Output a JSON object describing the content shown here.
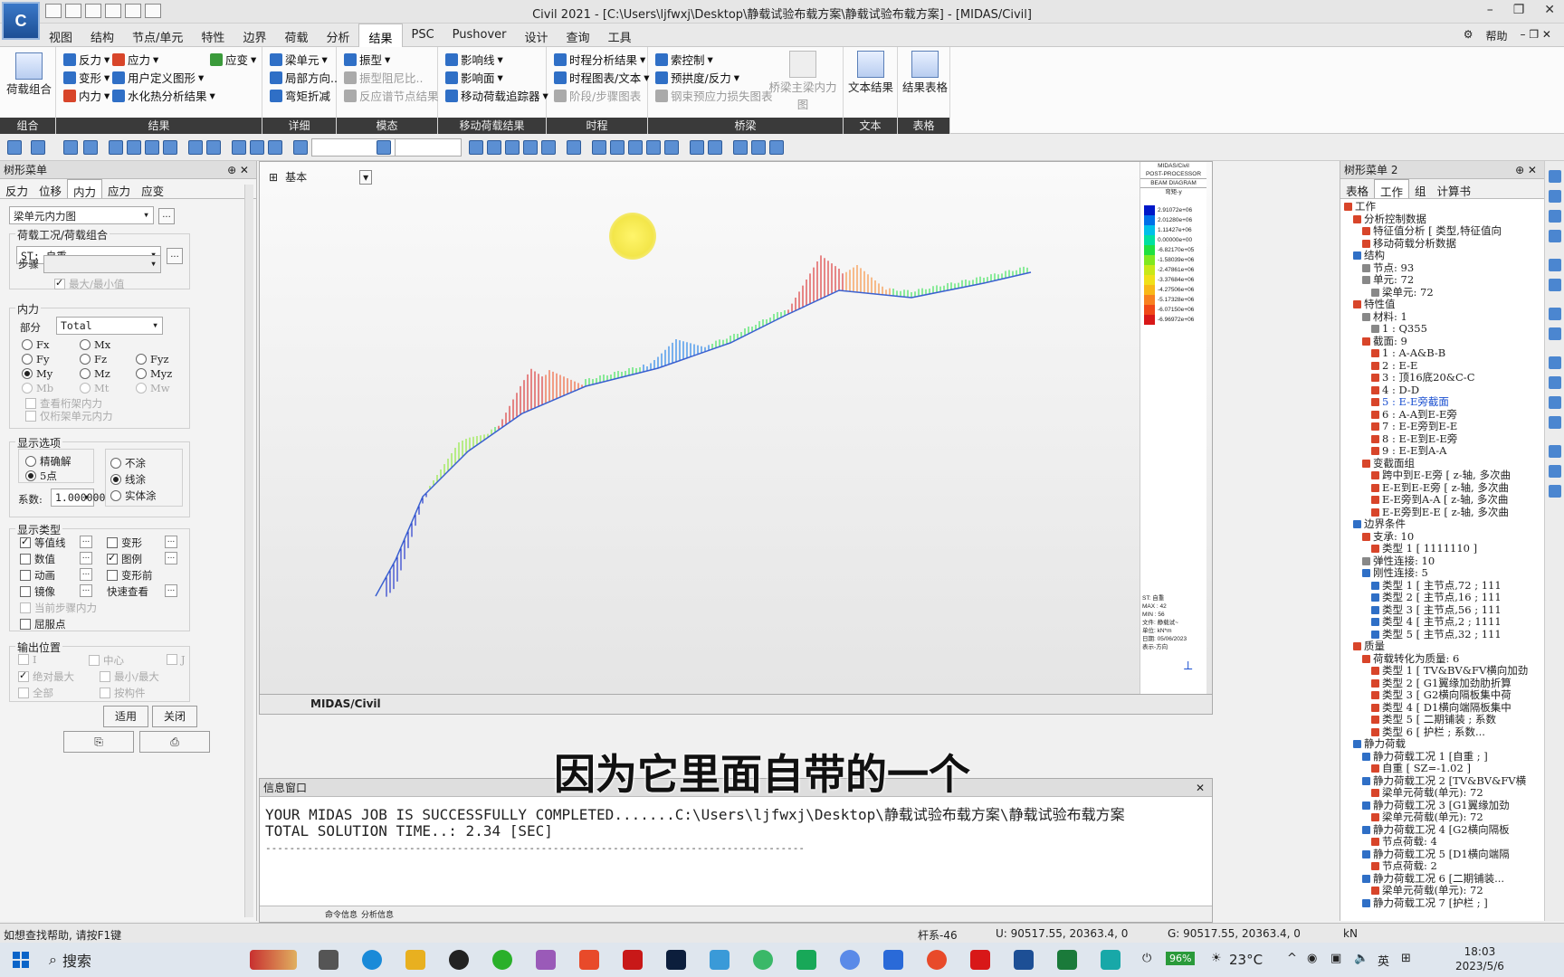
{
  "titlebar": {
    "logo": "C",
    "title": "Civil 2021 - [C:\\Users\\ljfwxj\\Desktop\\静载试验布载方案\\静载试验布载方案] - [MIDAS/Civil]",
    "controls": [
      "–",
      "❐",
      "✕"
    ]
  },
  "menu": {
    "tabs": [
      "视图",
      "结构",
      "节点/单元",
      "特性",
      "边界",
      "荷载",
      "分析",
      "结果",
      "PSC",
      "Pushover",
      "设计",
      "查询",
      "工具"
    ],
    "active": "结果",
    "help": "帮助"
  },
  "ribbon": {
    "groups": {
      "combo": "组合",
      "result": "结果",
      "detail": "详细",
      "mode": "模态",
      "moving": "移动荷载结果",
      "time": "时程",
      "bridge": "桥梁",
      "text": "文本",
      "table": "表格"
    },
    "load_combo": "荷载组合",
    "result_items": [
      "反力",
      "变形",
      "内力",
      "应力",
      "用户定义图形",
      "水化热分析结果",
      "应变"
    ],
    "detail_items": [
      "梁单元",
      "局部方向..",
      "弯矩折减"
    ],
    "mode_items": [
      "振型",
      "振型阻尼比..",
      "反应谱节点结果"
    ],
    "moving_items": [
      "影响线",
      "影响面",
      "移动荷载追踪器"
    ],
    "time_items": [
      "时程分析结果",
      "时程图表/文本",
      "阶段/步骤图表"
    ],
    "bridge_items": [
      "索控制",
      "预拱度/反力",
      "钢束预应力损失图表",
      "桥梁主梁内力图"
    ],
    "text_result": "文本结果",
    "table_result": "结果表格"
  },
  "left_panel": {
    "title": "树形菜单",
    "tabs": [
      "反力",
      "位移",
      "内力",
      "应力",
      "应变"
    ],
    "active_tab": "内力",
    "type_select": "梁单元内力图",
    "loadcase_label": "荷载工况/荷载组合",
    "loadcase_value": "ST: 自重",
    "step_label": "步骤",
    "maxmin_label": "最大/最小值",
    "force_label": "内力",
    "part_label": "部分",
    "part_value": "Total",
    "components": [
      "Fx",
      "Mx",
      "Fy",
      "Fz",
      "Fyz",
      "My",
      "Mz",
      "Myz",
      "Mb",
      "Mt",
      "Mw"
    ],
    "truss_force": "查看桁架内力",
    "truss_only": "仅桁架单元内力",
    "display_options_label": "显示选项",
    "exact": "精确解",
    "five_points": "5点",
    "fill_none": "不涂",
    "fill_line": "线涂",
    "fill_solid": "实体涂",
    "factor_label": "系数:",
    "factor_value": "1.000000",
    "display_type_label": "显示类型",
    "display_types": [
      "等值线",
      "变形",
      "数值",
      "图例",
      "动画",
      "变形前",
      "镜像",
      "快速查看",
      "当前步骤内力",
      "屈服点"
    ],
    "output_pos_label": "输出位置",
    "output_pos": [
      "I",
      "中心",
      "J",
      "绝对最大",
      "最小/最大",
      "全部",
      "按构件"
    ],
    "apply": "适用",
    "close": "关闭"
  },
  "viewport": {
    "view_label": "基本",
    "bottom_tab": "MIDAS/Civil",
    "legend_header": [
      "MIDAS/Civil",
      "POST-PROCESSOR",
      "BEAM DIAGRAM",
      "弯矩-y"
    ],
    "legend_values": [
      "2.91072e+06",
      "2.01280e+06",
      "1.11427e+06",
      "0.00000e+00",
      "-6.82170e+05",
      "-1.58039e+06",
      "-2.47861e+06",
      "-3.37684e+06",
      "-4.27506e+06",
      "-5.17328e+06",
      "-6.07150e+06",
      "-6.96972e+06"
    ],
    "legend_colors": [
      "#0018c8",
      "#0070e8",
      "#00c0e8",
      "#00e0a0",
      "#20e040",
      "#80e820",
      "#c8e818",
      "#f0e018",
      "#f8b818",
      "#f88020",
      "#f04818",
      "#d81818"
    ],
    "legend_footer": [
      "ST: 自重",
      "MAX : 42",
      "MIN : 56",
      "文件: 静载试~",
      "单位: kN*m",
      "日期: 05/06/2023",
      "表示-方向"
    ]
  },
  "subtitle": "因为它里面自带的一个",
  "message_window": {
    "title": "信息窗口",
    "line1": "YOUR MIDAS JOB IS SUCCESSFULLY COMPLETED.......C:\\Users\\ljfwxj\\Desktop\\静载试验布载方案\\静载试验布载方案",
    "line2": "TOTAL SOLUTION TIME..:     2.34 [SEC]",
    "line3": "------------------------------------------------------------------------------------------",
    "tabs": [
      "命令信息",
      "分析信息"
    ]
  },
  "right_panel": {
    "title": "树形菜单 2",
    "tabs": [
      "表格",
      "工作",
      "组",
      "计算书"
    ],
    "active_tab": "工作",
    "tree": [
      {
        "t": "工作",
        "d": 0,
        "c": "#d8452a"
      },
      {
        "t": "分析控制数据",
        "d": 1,
        "c": "#d8452a"
      },
      {
        "t": "特征值分析 [ 类型,特征值向",
        "d": 2,
        "c": "#d8452a"
      },
      {
        "t": "移动荷载分析数据",
        "d": 2,
        "c": "#d8452a"
      },
      {
        "t": "结构",
        "d": 1,
        "c": "#2f6fc6"
      },
      {
        "t": "节点: 93",
        "d": 2,
        "c": "#888"
      },
      {
        "t": "单元: 72",
        "d": 2,
        "c": "#888"
      },
      {
        "t": "梁单元: 72",
        "d": 3,
        "c": "#888"
      },
      {
        "t": "特性值",
        "d": 1,
        "c": "#d8452a"
      },
      {
        "t": "材料: 1",
        "d": 2,
        "c": "#888"
      },
      {
        "t": "1 : Q355",
        "d": 3,
        "c": "#888"
      },
      {
        "t": "截面: 9",
        "d": 2,
        "c": "#d8452a"
      },
      {
        "t": "1 : A-A&B-B",
        "d": 3,
        "c": "#d8452a"
      },
      {
        "t": "2 : E-E",
        "d": 3,
        "c": "#d8452a"
      },
      {
        "t": "3 : 顶16底20&C-C",
        "d": 3,
        "c": "#d8452a"
      },
      {
        "t": "4 : D-D",
        "d": 3,
        "c": "#d8452a"
      },
      {
        "t": "5 : E-E旁截面",
        "d": 3,
        "c": "#d8452a",
        "link": true
      },
      {
        "t": "6 : A-A到E-E旁",
        "d": 3,
        "c": "#d8452a"
      },
      {
        "t": "7 : E-E旁到E-E",
        "d": 3,
        "c": "#d8452a"
      },
      {
        "t": "8 : E-E到E-E旁",
        "d": 3,
        "c": "#d8452a"
      },
      {
        "t": "9 : E-E到A-A",
        "d": 3,
        "c": "#d8452a"
      },
      {
        "t": "变截面组",
        "d": 2,
        "c": "#d8452a"
      },
      {
        "t": "跨中到E-E旁 [ z-轴, 多次曲",
        "d": 3,
        "c": "#d8452a"
      },
      {
        "t": "E-E到E-E旁 [ z-轴, 多次曲",
        "d": 3,
        "c": "#d8452a"
      },
      {
        "t": "E-E旁到A-A [ z-轴, 多次曲",
        "d": 3,
        "c": "#d8452a"
      },
      {
        "t": "E-E旁到E-E [ z-轴, 多次曲",
        "d": 3,
        "c": "#d8452a"
      },
      {
        "t": "边界条件",
        "d": 1,
        "c": "#2f6fc6"
      },
      {
        "t": "支承: 10",
        "d": 2,
        "c": "#d8452a"
      },
      {
        "t": "类型 1 [ 1111110 ]",
        "d": 3,
        "c": "#d8452a"
      },
      {
        "t": "弹性连接: 10",
        "d": 2,
        "c": "#888"
      },
      {
        "t": "刚性连接: 5",
        "d": 2,
        "c": "#2f6fc6"
      },
      {
        "t": "类型 1 [ 主节点,72 ; 111",
        "d": 3,
        "c": "#2f6fc6"
      },
      {
        "t": "类型 2 [ 主节点,16 ; 111",
        "d": 3,
        "c": "#2f6fc6"
      },
      {
        "t": "类型 3 [ 主节点,56 ; 111",
        "d": 3,
        "c": "#2f6fc6"
      },
      {
        "t": "类型 4 [ 主节点,2 ; 1111",
        "d": 3,
        "c": "#2f6fc6"
      },
      {
        "t": "类型 5 [ 主节点,32 ; 111",
        "d": 3,
        "c": "#2f6fc6"
      },
      {
        "t": "质量",
        "d": 1,
        "c": "#d8452a"
      },
      {
        "t": "荷载转化为质量: 6",
        "d": 2,
        "c": "#d8452a"
      },
      {
        "t": "类型 1 [ TV&BV&FV横向加劲",
        "d": 3,
        "c": "#d8452a"
      },
      {
        "t": "类型 2 [ G1翼缘加劲肋折算",
        "d": 3,
        "c": "#d8452a"
      },
      {
        "t": "类型 3 [ G2横向隔板集中荷",
        "d": 3,
        "c": "#d8452a"
      },
      {
        "t": "类型 4 [ D1横向端隔板集中",
        "d": 3,
        "c": "#d8452a"
      },
      {
        "t": "类型 5 [ 二期铺装 ; 系数",
        "d": 3,
        "c": "#d8452a"
      },
      {
        "t": "类型 6 [ 护栏 ; 系数...",
        "d": 3,
        "c": "#d8452a"
      },
      {
        "t": "静力荷载",
        "d": 1,
        "c": "#2f6fc6"
      },
      {
        "t": "静力荷载工况 1 [自重 ; ]",
        "d": 2,
        "c": "#2f6fc6"
      },
      {
        "t": "自重 [ SZ=-1.02 ]",
        "d": 3,
        "c": "#d8452a"
      },
      {
        "t": "静力荷载工况 2 [TV&BV&FV横",
        "d": 2,
        "c": "#2f6fc6"
      },
      {
        "t": "梁单元荷载(单元): 72",
        "d": 3,
        "c": "#d8452a"
      },
      {
        "t": "静力荷载工况 3 [G1翼缘加劲",
        "d": 2,
        "c": "#2f6fc6"
      },
      {
        "t": "梁单元荷载(单元): 72",
        "d": 3,
        "c": "#d8452a"
      },
      {
        "t": "静力荷载工况 4 [G2横向隔板",
        "d": 2,
        "c": "#2f6fc6"
      },
      {
        "t": "节点荷载: 4",
        "d": 3,
        "c": "#d8452a"
      },
      {
        "t": "静力荷载工况 5 [D1横向端隔",
        "d": 2,
        "c": "#2f6fc6"
      },
      {
        "t": "节点荷载: 2",
        "d": 3,
        "c": "#d8452a"
      },
      {
        "t": "静力荷载工况 6 [二期铺装...",
        "d": 2,
        "c": "#2f6fc6"
      },
      {
        "t": "梁单元荷载(单元): 72",
        "d": 3,
        "c": "#d8452a"
      },
      {
        "t": "静力荷载工况 7 [护栏 ; ]",
        "d": 2,
        "c": "#2f6fc6"
      }
    ]
  },
  "statusbar": {
    "hint": "如想查找帮助, 请按F1键",
    "frame": "杆系-46",
    "u_coord": "U: 90517.55, 20363.4, 0",
    "g_coord": "G: 90517.55, 20363.4, 0",
    "unit": "kN"
  },
  "taskbar": {
    "search": "搜索",
    "battery": "96%",
    "temperature": "23°C",
    "ime": "英",
    "time": "18:03",
    "date": "2023/5/6"
  }
}
